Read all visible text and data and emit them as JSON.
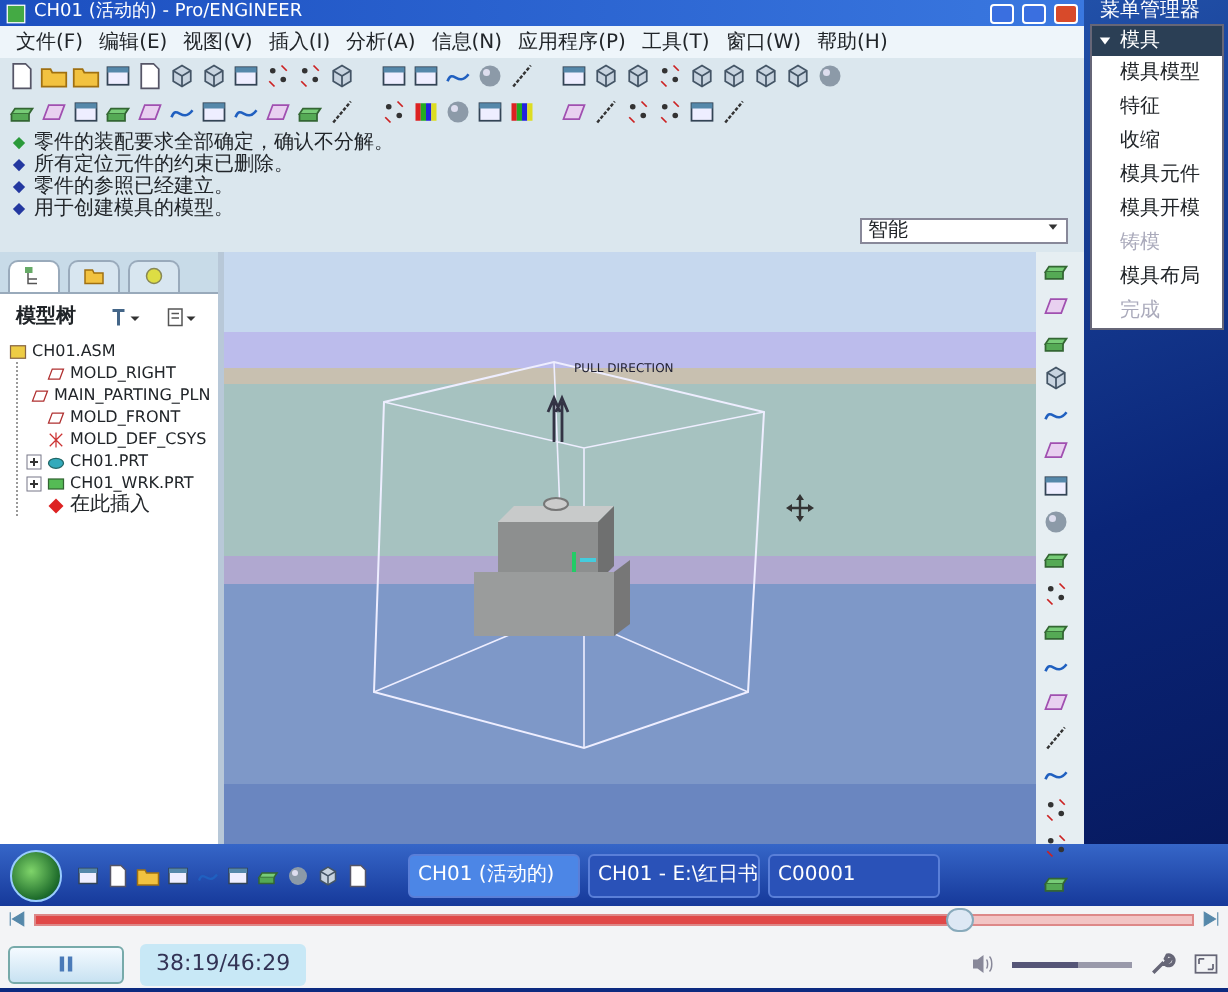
{
  "window": {
    "title": "CH01 (活动的) - Pro/ENGINEER"
  },
  "menu": [
    "文件(F)",
    "编辑(E)",
    "视图(V)",
    "插入(I)",
    "分析(A)",
    "信息(N)",
    "应用程序(P)",
    "工具(T)",
    "窗口(W)",
    "帮助(H)"
  ],
  "messages": [
    {
      "kind": "prompt",
      "text": "零件的装配要求全部确定，确认不分解。"
    },
    {
      "kind": "info",
      "text": "所有定位元件的约束已删除。"
    },
    {
      "kind": "info",
      "text": "零件的参照已经建立。"
    },
    {
      "kind": "info",
      "text": "用于创建模具的模型。"
    }
  ],
  "filter": {
    "value": "智能"
  },
  "panel_tabs": [
    {
      "selected": true
    },
    {
      "selected": false
    },
    {
      "selected": false
    }
  ],
  "model_tree": {
    "title": "模型树",
    "items": [
      {
        "label": "CH01.ASM",
        "kind": "assembly",
        "children": [
          {
            "label": "MOLD_RIGHT",
            "kind": "plane"
          },
          {
            "label": "MAIN_PARTING_PLN",
            "kind": "plane"
          },
          {
            "label": "MOLD_FRONT",
            "kind": "plane"
          },
          {
            "label": "MOLD_DEF_CSYS",
            "kind": "csys"
          },
          {
            "label": "CH01.PRT",
            "kind": "part",
            "expanded": false
          },
          {
            "label": "CH01_WRK.PRT",
            "kind": "workpiece",
            "expanded": false
          },
          {
            "label": "在此插入",
            "kind": "insert"
          }
        ]
      }
    ]
  },
  "viewport": {
    "label": "PULL DIRECTION"
  },
  "menu_manager": {
    "title": "菜单管理器",
    "header": "模具",
    "items": [
      {
        "label": "模具模型",
        "disabled": false
      },
      {
        "label": "特征",
        "disabled": false
      },
      {
        "label": "收缩",
        "disabled": false
      },
      {
        "label": "模具元件",
        "disabled": false
      },
      {
        "label": "模具开模",
        "disabled": false
      },
      {
        "label": "铸模",
        "disabled": true
      },
      {
        "label": "模具布局",
        "disabled": false
      },
      {
        "label": "完成",
        "disabled": true
      }
    ]
  },
  "taskbar": {
    "tasks": [
      {
        "label": "CH01 (活动的)",
        "selected": true
      },
      {
        "label": "CH01 - E:\\红日书",
        "selected": false
      },
      {
        "label": "C00001",
        "selected": false
      }
    ]
  },
  "player": {
    "progress": {
      "level": 0.8
    },
    "time": "38:19/46:29",
    "volume": {
      "level": 0.55
    }
  }
}
